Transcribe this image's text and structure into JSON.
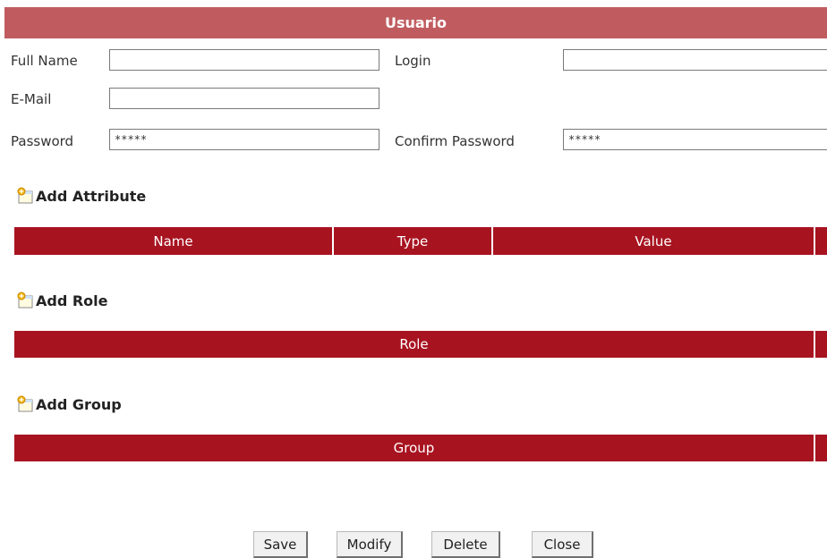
{
  "form": {
    "title": "Usuario",
    "full_name_label": "Full Name",
    "full_name_value": "",
    "login_label": "Login",
    "login_value": "",
    "email_label": "E-Mail",
    "email_value": "",
    "password_label": "Password",
    "password_value": "*****",
    "confirm_password_label": "Confirm Password",
    "confirm_password_value": "*****"
  },
  "attributes": {
    "add_label": "Add Attribute",
    "columns": [
      "Name",
      "Type",
      "Value"
    ]
  },
  "roles": {
    "add_label": "Add Role",
    "columns": [
      "Role"
    ]
  },
  "groups": {
    "add_label": "Add Group",
    "columns": [
      "Group"
    ]
  },
  "buttons": {
    "save": "Save",
    "modify": "Modify",
    "delete": "Delete",
    "close": "Close"
  },
  "colors": {
    "title_bar": "#c05c60",
    "grid_header": "#a81320"
  }
}
